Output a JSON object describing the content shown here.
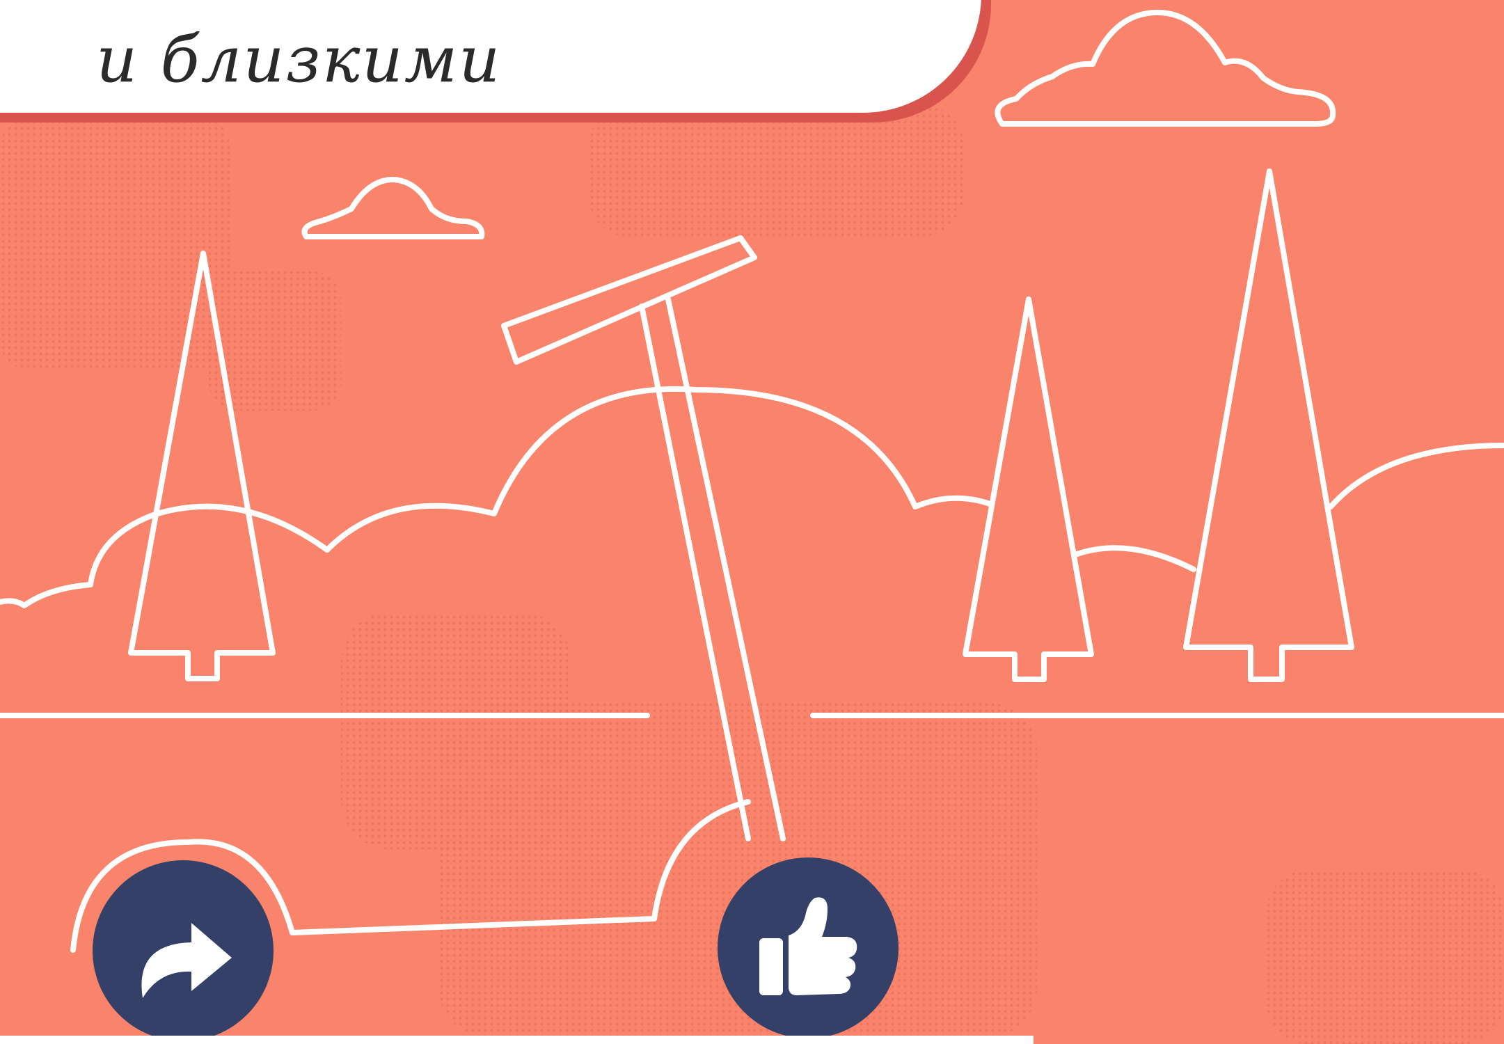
{
  "title": {
    "line1": "",
    "line2": "и близкими"
  },
  "buttons": {
    "share_icon": "share-arrow-icon",
    "like_icon": "thumbs-up-icon"
  },
  "colors": {
    "background": "#F9846B",
    "line_art": "#FFFFFF",
    "button_fill": "#344067",
    "card_shadow": "#D9544C"
  }
}
